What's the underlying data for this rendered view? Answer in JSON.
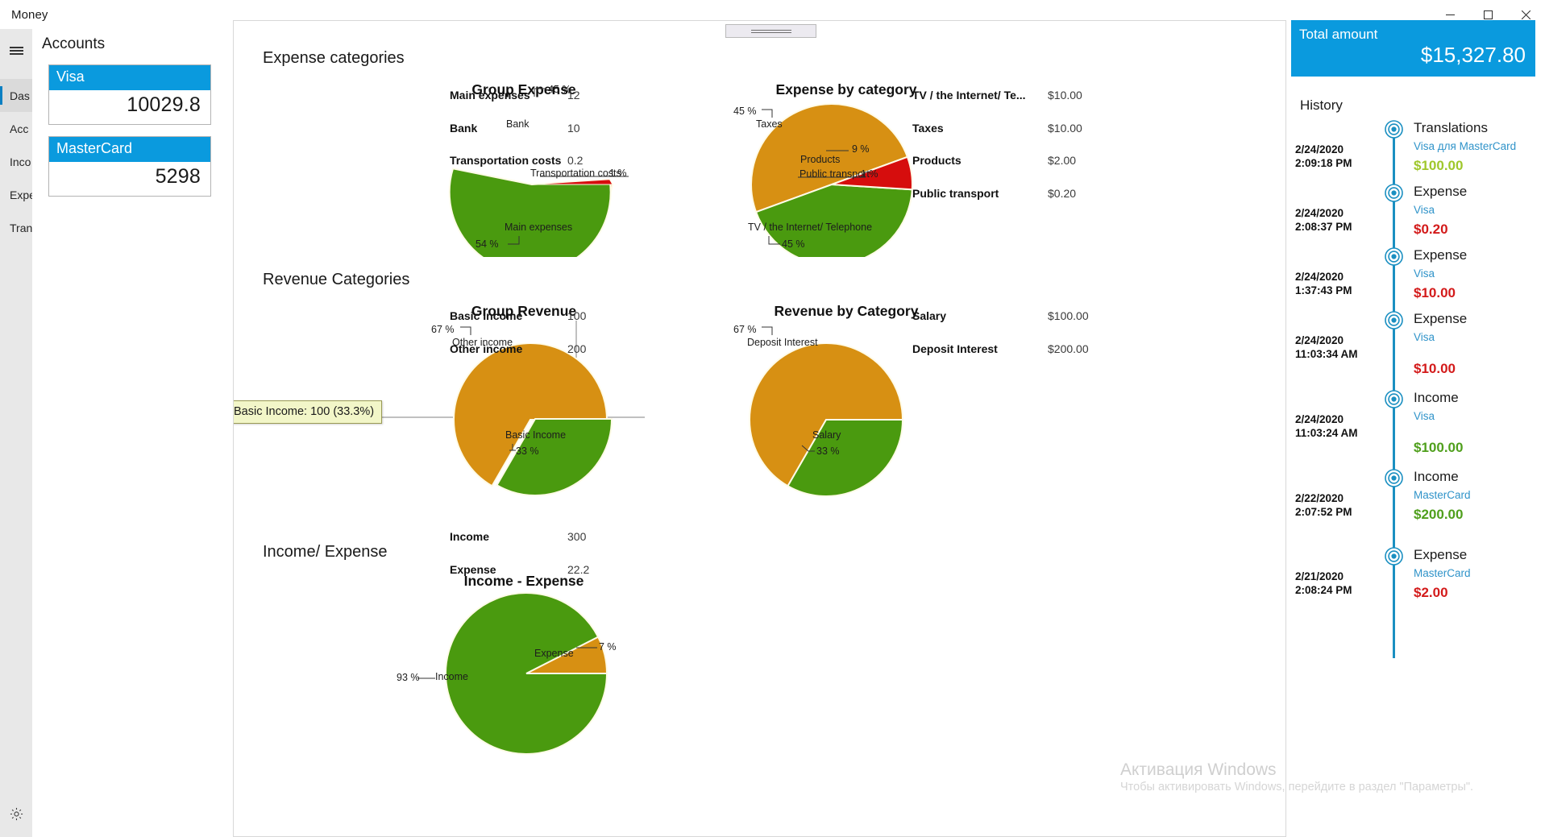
{
  "window": {
    "title": "Money",
    "minimize_icon": "minimize-icon",
    "maximize_icon": "maximize-icon",
    "close_icon": "close-icon"
  },
  "rail": {
    "menu_icon": "hamburger-icon",
    "settings_icon": "gear-icon",
    "items": [
      {
        "label": "Das",
        "active": true
      },
      {
        "label": "Acc",
        "active": false
      },
      {
        "label": "Inco",
        "active": false
      },
      {
        "label": "Expe",
        "active": false
      },
      {
        "label": "Tran",
        "active": false
      }
    ]
  },
  "accounts": {
    "heading": "Accounts",
    "cards": [
      {
        "name": "Visa",
        "balance": "10029.8"
      },
      {
        "name": "MasterCard",
        "balance": "5298"
      }
    ]
  },
  "sections": {
    "expense": "Expense categories",
    "revenue": "Revenue Categories",
    "income_expense": "Income/ Expense"
  },
  "tooltip": {
    "text": "Basic Income: 100 (33.3%)"
  },
  "colors": {
    "accent": "#0a9ade",
    "orange": "#d79013",
    "green": "#4a9a0f",
    "red": "#d60d0d",
    "positive": "#4f9f1c",
    "negative": "#d31a1a",
    "lime": "#9fc72b",
    "timeline": "#1a8fc1"
  },
  "chart_data": [
    {
      "type": "pie",
      "title": "Group Expense",
      "categories": [
        "Bank",
        "Main expenses",
        "Transportation costs"
      ],
      "values": [
        10,
        12,
        0.2
      ],
      "percents": [
        "45 %",
        "54 %",
        "1 %"
      ],
      "colors": [
        "#d79013",
        "#4a9a0f",
        "#d60d0d"
      ],
      "legend": {
        "rows": [
          {
            "label": "Main expenses",
            "value": "12"
          },
          {
            "label": "Bank",
            "value": "10"
          },
          {
            "label": "Transportation costs",
            "value": "0.2"
          }
        ]
      }
    },
    {
      "type": "pie",
      "title": "Expense by category",
      "categories": [
        "Taxes",
        "TV / the Internet/ Telephone",
        "Products",
        "Public transport"
      ],
      "values": [
        10,
        10,
        2,
        0.2
      ],
      "percents": [
        "45 %",
        "45 %",
        "9 %",
        "1 %"
      ],
      "colors": [
        "#d79013",
        "#4a9a0f",
        "#d60d0d",
        "#d60d0d"
      ],
      "legend": {
        "rows": [
          {
            "label": "TV / the Internet/ Te...",
            "value": "$10.00"
          },
          {
            "label": "Taxes",
            "value": "$10.00"
          },
          {
            "label": "Products",
            "value": "$2.00"
          },
          {
            "label": "Public transport",
            "value": "$0.20"
          }
        ]
      }
    },
    {
      "type": "pie",
      "title": "Group Revenue",
      "categories": [
        "Other income",
        "Basic Income"
      ],
      "values": [
        200,
        100
      ],
      "percents": [
        "67 %",
        "33 %"
      ],
      "colors": [
        "#d79013",
        "#4a9a0f"
      ],
      "legend": {
        "rows": [
          {
            "label": "Basic Income",
            "value": "100"
          },
          {
            "label": "Other income",
            "value": "200"
          }
        ]
      }
    },
    {
      "type": "pie",
      "title": "Revenue by Category",
      "categories": [
        "Deposit Interest",
        "Salary"
      ],
      "values": [
        200,
        100
      ],
      "percents": [
        "67 %",
        "33 %"
      ],
      "colors": [
        "#d79013",
        "#4a9a0f"
      ],
      "legend": {
        "rows": [
          {
            "label": "Salary",
            "value": "$100.00"
          },
          {
            "label": "Deposit Interest",
            "value": "$200.00"
          }
        ]
      }
    },
    {
      "type": "pie",
      "title": "Income - Expense",
      "categories": [
        "Income",
        "Expense"
      ],
      "values": [
        300,
        22.2
      ],
      "percents": [
        "93 %",
        "7 %"
      ],
      "colors": [
        "#4a9a0f",
        "#d79013"
      ],
      "legend": {
        "rows": [
          {
            "label": "Income",
            "value": "300"
          },
          {
            "label": "Expense",
            "value": "22.2"
          }
        ]
      }
    }
  ],
  "right": {
    "total_label": "Total amount",
    "total_amount": "$15,327.80",
    "history_label": "History",
    "history": [
      {
        "date": "2/24/2020",
        "time": "2:09:18 PM",
        "title": "Translations",
        "account": "Visa для MasterCard",
        "amount": "$100.00",
        "kind": "lime"
      },
      {
        "date": "2/24/2020",
        "time": "2:08:37 PM",
        "title": "Expense",
        "account": "Visa",
        "amount": "$0.20",
        "kind": "neg"
      },
      {
        "date": "2/24/2020",
        "time": "1:37:43 PM",
        "title": "Expense",
        "account": "Visa",
        "amount": "$10.00",
        "kind": "neg"
      },
      {
        "date": "2/24/2020",
        "time": "11:03:34 AM",
        "title": "Expense",
        "account": "Visa",
        "amount": "$10.00",
        "kind": "neg"
      },
      {
        "date": "2/24/2020",
        "time": "11:03:24 AM",
        "title": "Income",
        "account": "Visa",
        "amount": "$100.00",
        "kind": "pos"
      },
      {
        "date": "2/22/2020",
        "time": "2:07:52 PM",
        "title": "Income",
        "account": "MasterCard",
        "amount": "$200.00",
        "kind": "pos"
      },
      {
        "date": "2/21/2020",
        "time": "2:08:24 PM",
        "title": "Expense",
        "account": "MasterCard",
        "amount": "$2.00",
        "kind": "neg"
      }
    ]
  },
  "watermark": {
    "line1": "Активация Windows",
    "line2": "Чтобы активировать Windows, перейдите в раздел \"Параметры\"."
  }
}
